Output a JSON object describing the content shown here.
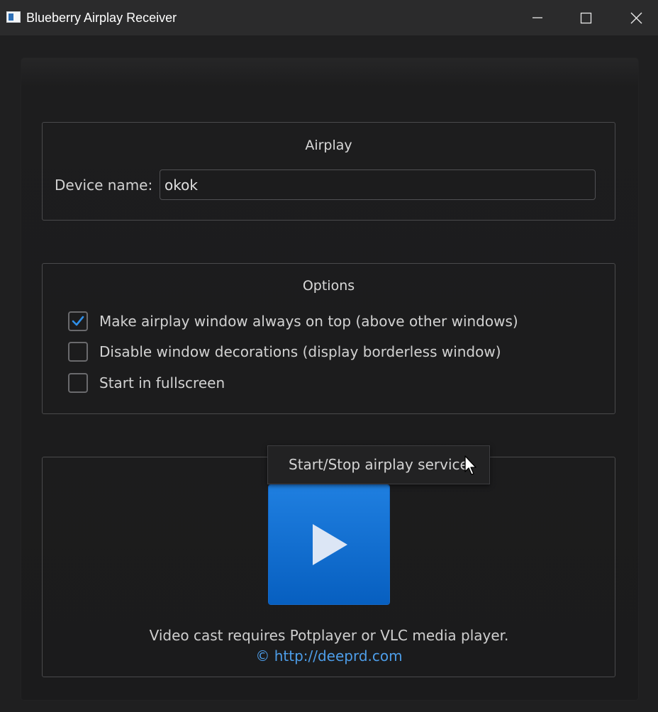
{
  "window": {
    "title": "Blueberry Airplay Receiver",
    "icon": "app-window-icon",
    "controls": {
      "minimize_icon": "minimize-icon",
      "maximize_icon": "maximize-icon",
      "close_icon": "close-icon"
    }
  },
  "airplay": {
    "title": "Airplay",
    "device_label": "Device name:",
    "device_value": "okok"
  },
  "options": {
    "title": "Options",
    "items": [
      {
        "label": "Make airplay window always on top (above other windows)",
        "checked": true
      },
      {
        "label": "Disable window decorations (display borderless window)",
        "checked": false
      },
      {
        "label": "Start in fullscreen",
        "checked": false
      }
    ]
  },
  "service": {
    "tooltip": "Start/Stop airplay service",
    "button_icon": "play-icon",
    "note": "Video cast requires Potplayer or VLC media player.",
    "link": "© http://deeprd.com"
  },
  "colors": {
    "accent": "#1674d8",
    "link": "#4d9de8",
    "background": "#1f1f20",
    "titlebar": "#2b2b2c"
  }
}
